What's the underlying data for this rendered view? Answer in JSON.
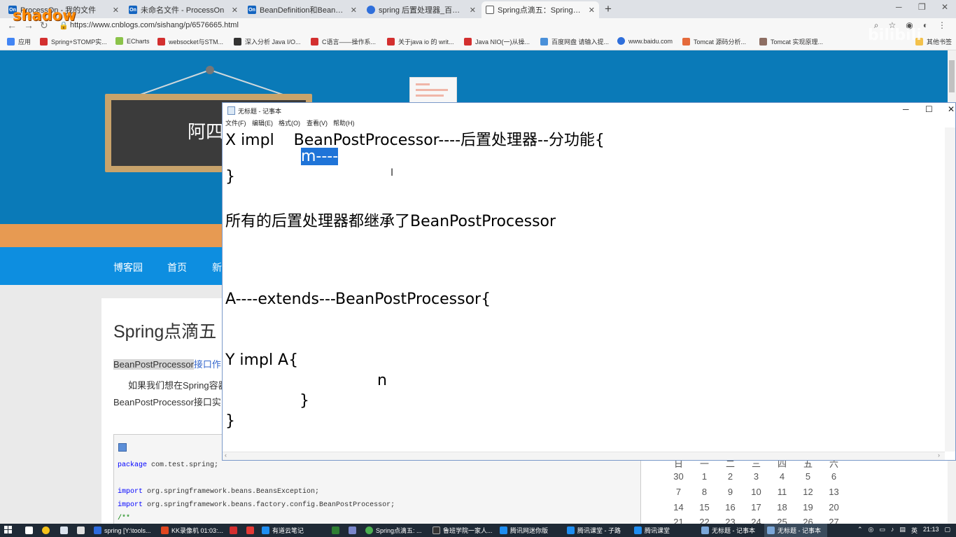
{
  "browser": {
    "tabs": [
      {
        "label": "ProcessOn - 我的文件",
        "icon": "On",
        "color": "#1565c0"
      },
      {
        "label": "未命名文件 - ProcessOn",
        "icon": "On",
        "color": "#1565c0"
      },
      {
        "label": "BeanDefinition和BeanFactoryP",
        "icon": "On",
        "color": "#1565c0"
      },
      {
        "label": "spring 后置处理器_百度搜索",
        "icon": "paw",
        "color": "#2f6fdb"
      },
      {
        "label": "Spring点滴五：Spring中的后置",
        "icon": "cnb",
        "color": "#555555"
      }
    ],
    "new_tab_label": "+",
    "url": "https://www.cnblogs.com/sishang/p/6576665.html",
    "bookmarks": [
      {
        "label": "应用",
        "color": "#4285f4"
      },
      {
        "label": "Spring+STOMP实...",
        "color": "#d32f2f"
      },
      {
        "label": "ECharts",
        "color": "#8bc34a"
      },
      {
        "label": "websocket与STM...",
        "color": "#d32f2f"
      },
      {
        "label": "深入分析 Java I/O...",
        "color": "#333333"
      },
      {
        "label": "C语言——操作系...",
        "color": "#d32f2f"
      },
      {
        "label": "关于java io 的 writ...",
        "color": "#d32f2f"
      },
      {
        "label": "Java NIO(一)从操...",
        "color": "#d32f2f"
      },
      {
        "label": "百度网盘 请输入提...",
        "color": "#4a90d9"
      },
      {
        "label": "www.baidu.com",
        "color": "#2f6fdb"
      },
      {
        "label": "Tomcat 源码分析...",
        "color": "#e56a3b"
      },
      {
        "label": "Tomcat 实现原理...",
        "color": "#8d6e63"
      },
      {
        "label": "其他书签",
        "color": "#f3c14b"
      }
    ]
  },
  "blog": {
    "board_title": "阿四",
    "nav": [
      "博客园",
      "首页",
      "新"
    ],
    "post_title": "Spring点滴五",
    "line1_highlight": "BeanPostProcessor",
    "line1_rest": "接口作",
    "line2": "如果我们想在Spring容器",
    "line3": "BeanPostProcessor接口实",
    "code": [
      {
        "kw": "package",
        "rest": " com.test.spring;"
      },
      {
        "kw": "",
        "rest": ""
      },
      {
        "kw": "import",
        "rest": " org.springframework.beans.BeansException;"
      },
      {
        "kw": "import",
        "rest": " org.springframework.beans.factory.config.BeanPostProcessor;"
      },
      {
        "kw": "",
        "rest": "/**"
      }
    ],
    "calendar": {
      "header": [
        "日",
        "一",
        "二",
        "三",
        "四",
        "五",
        "六"
      ],
      "rows": [
        [
          "30",
          "1",
          "2",
          "3",
          "4",
          "5",
          "6"
        ],
        [
          "7",
          "8",
          "9",
          "10",
          "11",
          "12",
          "13"
        ],
        [
          "14",
          "15",
          "16",
          "17",
          "18",
          "19",
          "20"
        ],
        [
          "21",
          "22",
          "23",
          "24",
          "25",
          "26",
          "27"
        ]
      ]
    }
  },
  "notepad": {
    "title": "无标题 - 记事本",
    "menu": [
      "文件(F)",
      "编辑(E)",
      "格式(O)",
      "查看(V)",
      "帮助(H)"
    ],
    "lines": {
      "l1": "X impl    BeanPostProcessor----后置处理器--分功能{",
      "l2_selected": "m----",
      "l3": "}",
      "l4": "所有的后置处理器都继承了BeanPostProcessor",
      "l5": "A----extends---BeanPostProcessor{",
      "l6": "Y impl A{",
      "l7": "n",
      "l8": "}",
      "l9": "}"
    }
  },
  "taskbar": {
    "items": [
      {
        "label": "spring [Y:\\tools...",
        "color": "#2d6cdf"
      },
      {
        "label": "KK录像机 01:03:...",
        "color": "#e0461f"
      },
      {
        "label": "有道云笔记",
        "color": "#1f8ef1"
      },
      {
        "label": "Spring点滴五: ...",
        "color": "#4caf50"
      },
      {
        "label": "鲁班学院一家人...",
        "color": "#333333"
      },
      {
        "label": "腾讯网迷你版",
        "color": "#1f8ef1"
      },
      {
        "label": "腾讯课堂 - 子路",
        "color": "#1f8ef1"
      },
      {
        "label": "腾讯课堂",
        "color": "#1f8ef1"
      },
      {
        "label": "无标题 - 记事本",
        "color": "#7aa6d8"
      },
      {
        "label": "无标题 - 记事本",
        "color": "#7aa6d8"
      }
    ],
    "tray_ime": "英",
    "clock": "21:13"
  },
  "watermarks": {
    "left": "shadow",
    "right": "bilibili"
  }
}
